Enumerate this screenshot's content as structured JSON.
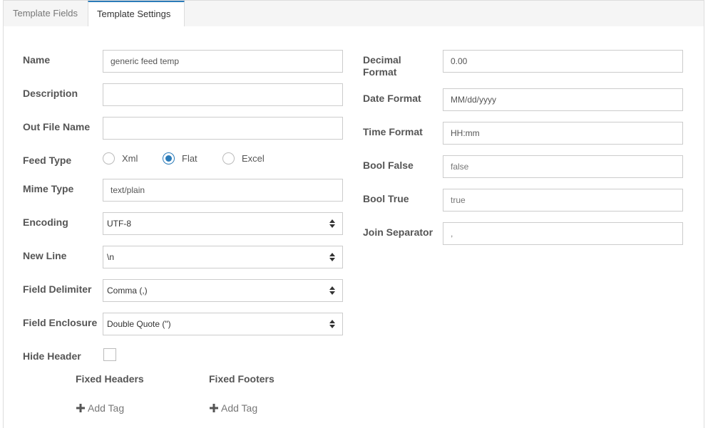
{
  "tabs": [
    {
      "label": "Template Fields",
      "active": false
    },
    {
      "label": "Template Settings",
      "active": true
    }
  ],
  "left": {
    "name": {
      "label": "Name",
      "value": "generic feed temp"
    },
    "description": {
      "label": "Description",
      "value": ""
    },
    "out_file_name": {
      "label": "Out File Name",
      "value": ""
    },
    "feed_type": {
      "label": "Feed Type",
      "options": [
        "Xml",
        "Flat",
        "Excel"
      ],
      "selected": "Flat"
    },
    "mime_type": {
      "label": "Mime Type",
      "value": "text/plain"
    },
    "encoding": {
      "label": "Encoding",
      "value": "UTF-8"
    },
    "new_line": {
      "label": "New Line",
      "value": "\\n"
    },
    "field_delimiter": {
      "label": "Field Delimiter",
      "value": "Comma (,)"
    },
    "field_enclosure": {
      "label": "Field Enclosure",
      "value": "Double Quote (\")"
    },
    "hide_header": {
      "label": "Hide Header",
      "checked": false
    },
    "fixed_headers": {
      "label": "Fixed Headers",
      "add_label": "Add Tag"
    },
    "fixed_footers": {
      "label": "Fixed Footers",
      "add_label": "Add Tag"
    }
  },
  "right": {
    "decimal_format": {
      "label_line1": "Decimal",
      "label_line2": "Format",
      "value": "0.00"
    },
    "date_format": {
      "label": "Date Format",
      "value": "MM/dd/yyyy"
    },
    "time_format": {
      "label": "Time Format",
      "value": "HH:mm"
    },
    "bool_false": {
      "label": "Bool False",
      "value": "false"
    },
    "bool_true": {
      "label": "Bool True",
      "value": "true"
    },
    "join_separator": {
      "label": "Join Separator",
      "value": ","
    }
  },
  "colors": {
    "accent": "#2b7bb9",
    "label": "#555555",
    "border": "#cccccc"
  }
}
